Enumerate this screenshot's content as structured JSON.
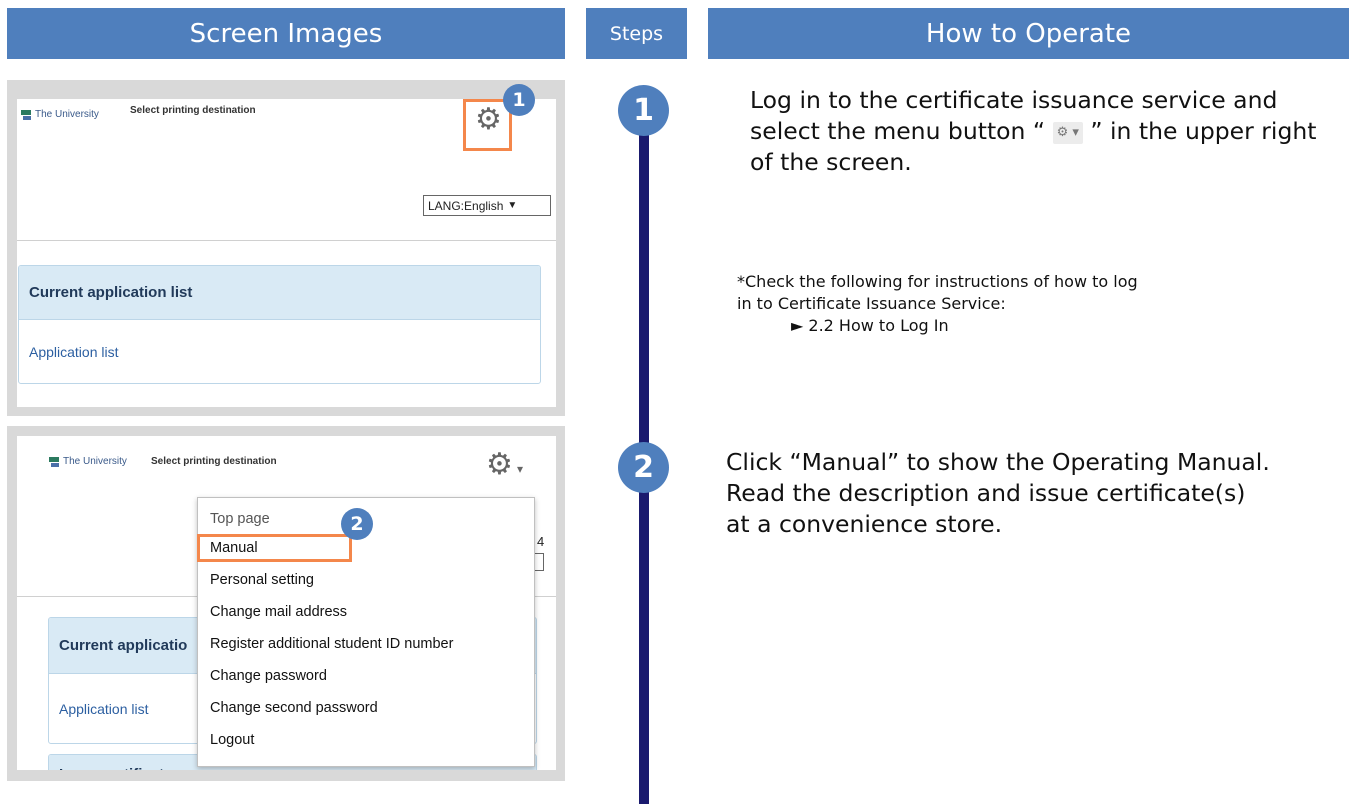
{
  "headers": {
    "screen_images": "Screen Images",
    "steps": "Steps",
    "how_to_operate": "How to Operate"
  },
  "screenshot1": {
    "logo_text": "The University",
    "page_title": "Select printing destination",
    "gear_icon": "gear-icon",
    "badge": "1",
    "lang_select": "LANG:English",
    "card_header": "Current application list",
    "card_link": "Application list"
  },
  "screenshot2": {
    "logo_text": "The University",
    "page_title": "Select printing destination",
    "gear_icon": "gear-icon",
    "badge": "2",
    "partial_right_digit": "4",
    "card_header_partial": "Current applicatio",
    "card_link": "Application list",
    "next_card_partial": "Issue certificate",
    "menu": [
      "Top page",
      "Manual",
      "Personal setting",
      "Change mail address",
      "Register additional student ID number",
      "Change password",
      "Change second password",
      "Logout"
    ]
  },
  "steps": [
    {
      "number": "1",
      "text_before_icon": "Log in to the certificate issuance service and select the menu button “",
      "text_after_icon": "” in the upper right of the screen.",
      "note_line1": "*Check the following for instructions of how to log",
      "note_line2": "in to Certificate Issuance Service:",
      "note_link": "► 2.2 How to Log In"
    },
    {
      "number": "2",
      "line1": "Click “Manual” to show the Operating Manual.",
      "line2": "Read the description and issue certificate(s)",
      "line3": "at a convenience store."
    }
  ],
  "colors": {
    "header_blue": "#4f7fbd",
    "timeline_navy": "#1a1a6e",
    "highlight_orange": "#f4874b",
    "card_header_bg": "#d9eaf5",
    "link_blue": "#2c5fa1"
  }
}
